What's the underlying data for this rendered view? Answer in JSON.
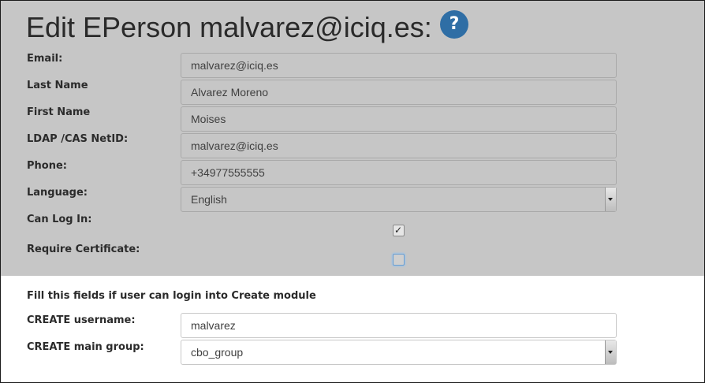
{
  "page": {
    "title": "Edit EPerson malvarez@iciq.es:",
    "help_glyph": "?"
  },
  "form": {
    "email": {
      "label": "Email:",
      "value": "malvarez@iciq.es"
    },
    "last_name": {
      "label": "Last Name",
      "value": "Alvarez Moreno"
    },
    "first_name": {
      "label": "First Name",
      "value": "Moises"
    },
    "netid": {
      "label": "LDAP /CAS NetID:",
      "value": "malvarez@iciq.es"
    },
    "phone": {
      "label": "Phone:",
      "value": "+34977555555"
    },
    "language": {
      "label": "Language:",
      "value": "English"
    },
    "can_log_in": {
      "label": "Can Log In:",
      "checked": true
    },
    "require_certificate": {
      "label": "Require Certificate:",
      "checked": false
    }
  },
  "create_module": {
    "note": "Fill this fields if user can login into Create module",
    "username": {
      "label": "CREATE username:",
      "value": "malvarez"
    },
    "main_group": {
      "label": "CREATE main group:",
      "value": "cbo_group"
    }
  },
  "colors": {
    "panel_gray": "#c6c6c6",
    "help_blue": "#2f6ea5"
  }
}
